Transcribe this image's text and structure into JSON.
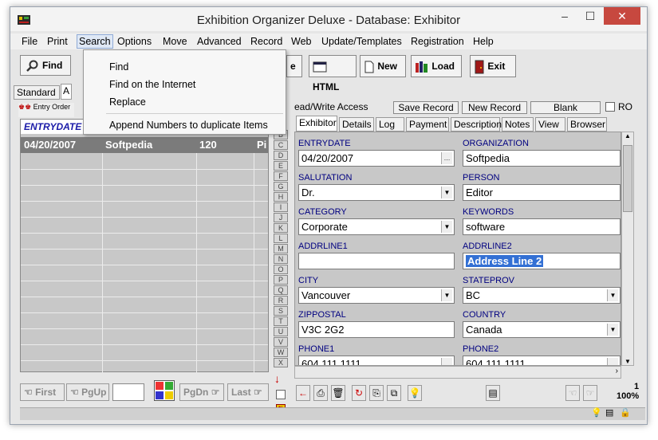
{
  "window": {
    "title": "Exhibition Organizer Deluxe - Database: Exhibitor"
  },
  "menubar": [
    "File",
    "Print",
    "Search",
    "Options",
    "Move",
    "Advanced",
    "Record",
    "Web",
    "Update/Templates",
    "Registration",
    "Help"
  ],
  "search_menu": [
    "Find",
    "Find on the Internet",
    "Replace",
    "Append Numbers to duplicate Items"
  ],
  "toolbar_left": {
    "find": "Find"
  },
  "toolbar_right": {
    "html": "HTML",
    "new": "New",
    "load": "Load",
    "exit": "Exit",
    "truncated": "e"
  },
  "left_tabs": {
    "standard": "Standard",
    "a": "A"
  },
  "entry_order_label": "Entry Order",
  "grid": {
    "header": "ENTRYDATE",
    "selected_row": [
      "04/20/2007",
      "Softpedia",
      "120",
      "Pi"
    ]
  },
  "alphabet": [
    "B",
    "C",
    "D",
    "E",
    "F",
    "G",
    "H",
    "I",
    "J",
    "K",
    "L",
    "M",
    "N",
    "O",
    "P",
    "Q",
    "R",
    "S",
    "T",
    "U",
    "V",
    "W",
    "X"
  ],
  "nav": {
    "first": "First",
    "pgup": "PgUp",
    "pgdn": "PgDn",
    "last": "Last"
  },
  "record_bar": {
    "access": "ead/Write Access",
    "save": "Save Record",
    "new": "New Record",
    "blank": "Blank",
    "ro": "RO"
  },
  "record_tabs": [
    "Exhibitor",
    "Details",
    "Log",
    "Payment",
    "Description",
    "Notes",
    "View",
    "Browser"
  ],
  "form": {
    "entrydate_label": "ENTRYDATE",
    "entrydate": "04/20/2007",
    "organization_label": "ORGANIZATION",
    "organization": "Softpedia",
    "salutation_label": "SALUTATION",
    "salutation": "Dr.",
    "person_label": "PERSON",
    "person": "Editor",
    "category_label": "CATEGORY",
    "category": "Corporate",
    "keywords_label": "KEYWORDS",
    "keywords": "software",
    "addrline1_label": "ADDRLINE1",
    "addrline1": "",
    "addrline2_label": "ADDRLINE2",
    "addrline2": "Address Line 2",
    "city_label": "CITY",
    "city": "Vancouver",
    "stateprov_label": "STATEPROV",
    "stateprov": "BC",
    "zippostal_label": "ZIPPOSTAL",
    "zippostal": "V3C 2G2",
    "country_label": "COUNTRY",
    "country": "Canada",
    "phone1_label": "PHONE1",
    "phone1": "604 111 1111",
    "phone2_label": "PHONE2",
    "phone2": "604 111 1111"
  },
  "pager": {
    "page": "1",
    "zoom": "100%"
  }
}
